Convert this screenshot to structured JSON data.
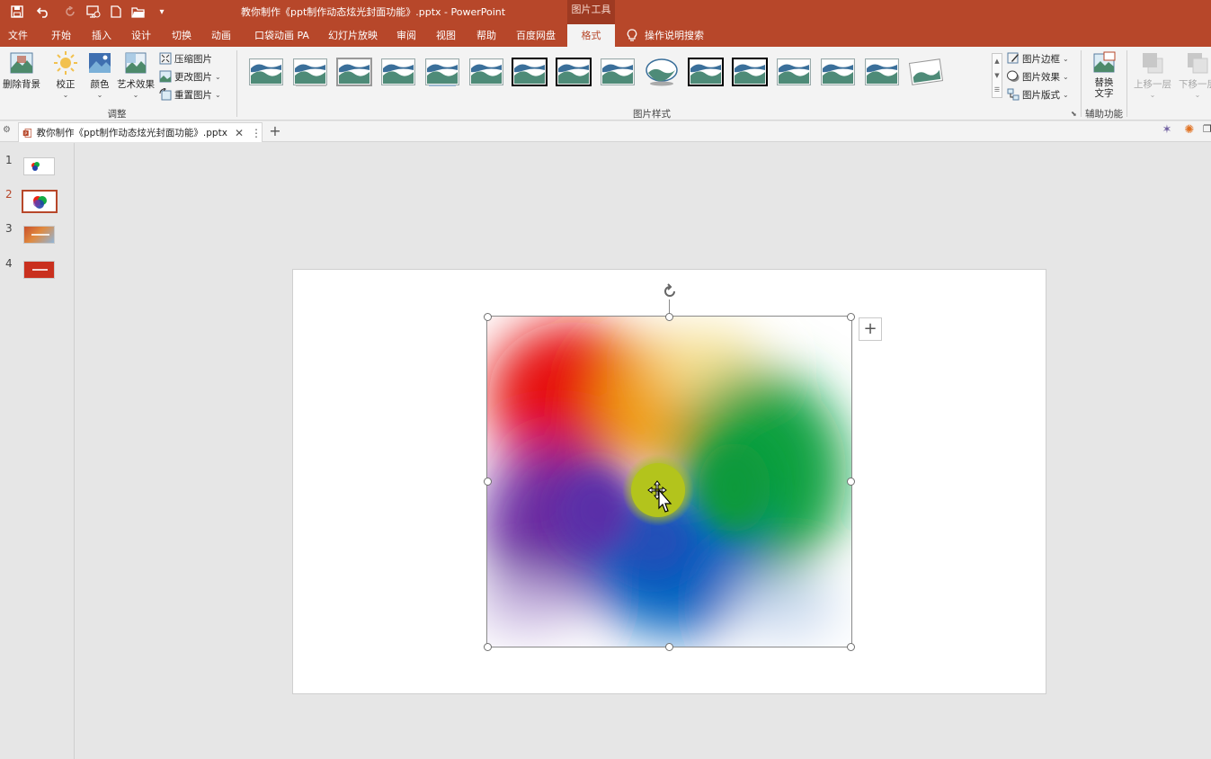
{
  "window": {
    "title": "教你制作《ppt制作动态炫光封面功能》.pptx  -  PowerPoint",
    "context_tab": "图片工具"
  },
  "tabs": [
    {
      "label": "文件"
    },
    {
      "label": "开始"
    },
    {
      "label": "插入"
    },
    {
      "label": "设计"
    },
    {
      "label": "切换"
    },
    {
      "label": "动画"
    },
    {
      "label": "口袋动画 PA"
    },
    {
      "label": "幻灯片放映"
    },
    {
      "label": "审阅"
    },
    {
      "label": "视图"
    },
    {
      "label": "帮助"
    },
    {
      "label": "百度网盘"
    },
    {
      "label": "格式",
      "active": true
    }
  ],
  "tell_me": "操作说明搜索",
  "ribbon": {
    "adjust": {
      "remove_bg": "删除背景",
      "corrections": "校正",
      "color": "颜色",
      "artistic": "艺术效果",
      "compress": "压缩图片",
      "change": "更改图片",
      "reset": "重置图片",
      "group_label": "调整"
    },
    "styles": {
      "group_label": "图片样式",
      "border": "图片边框",
      "effects": "图片效果",
      "layout": "图片版式"
    },
    "accessibility": {
      "alt_text_line1": "替换",
      "alt_text_line2": "文字",
      "group_label": "辅助功能"
    },
    "arrange": {
      "bring_forward": "上移一层",
      "send_backward": "下移一层"
    }
  },
  "doc_tab": {
    "name": "教你制作《ppt制作动态炫光封面功能》.pptx"
  },
  "slides": [
    {
      "number": "1"
    },
    {
      "number": "2",
      "current": true
    },
    {
      "number": "3"
    },
    {
      "number": "4"
    }
  ],
  "colors": {
    "accent": "#b7472a",
    "ribbon_bg": "#f3f3f3",
    "canvas_bg": "#e6e6e6"
  }
}
